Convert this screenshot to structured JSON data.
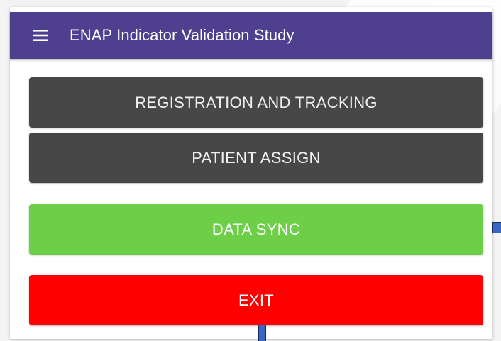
{
  "colors": {
    "appbar": "#4f3f8f",
    "dark_button": "#474747",
    "sync_button": "#6ccf47",
    "exit_button": "#ff0000",
    "marker": "#3b67c4"
  },
  "appbar": {
    "menu_icon": "hamburger-menu-icon",
    "title": "ENAP Indicator Validation Study"
  },
  "buttons": {
    "registration": "REGISTRATION AND TRACKING",
    "patient_assign": "PATIENT ASSIGN",
    "data_sync": "DATA SYNC",
    "exit": "EXIT"
  }
}
